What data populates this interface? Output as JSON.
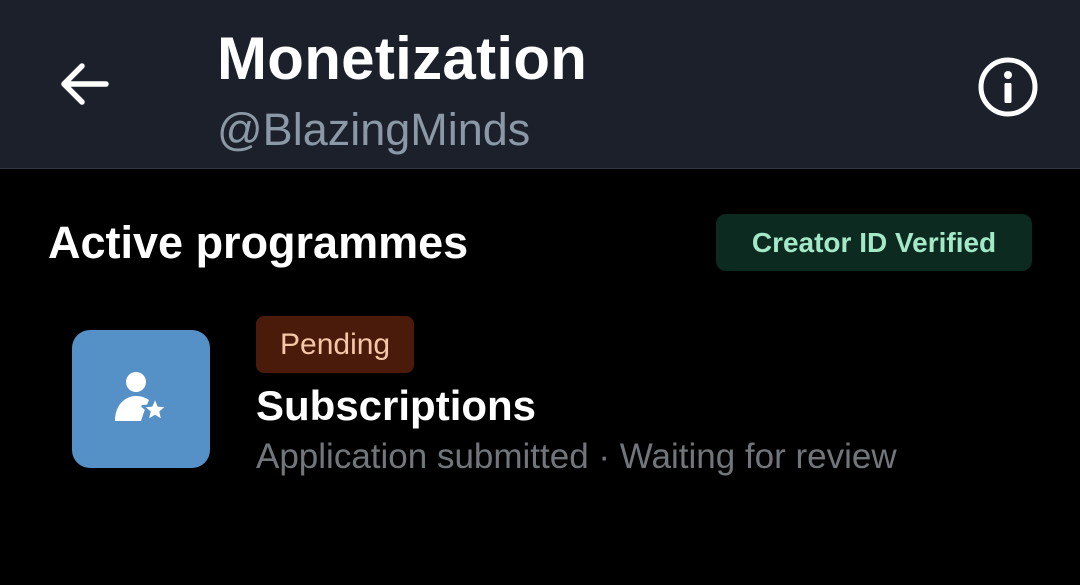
{
  "header": {
    "title": "Monetization",
    "handle": "@BlazingMinds",
    "back_icon": "arrow-left-icon",
    "info_icon": "info-circle-icon"
  },
  "section": {
    "title": "Active programmes",
    "verified_badge": "Creator ID Verified"
  },
  "programmes": [
    {
      "icon": "person-star-icon",
      "status_badge": "Pending",
      "name": "Subscriptions",
      "status_text": "Application submitted · Waiting for review"
    }
  ],
  "colors": {
    "header_bg": "#1b202b",
    "page_bg": "#000000",
    "verified_bg": "#0c2a20",
    "verified_text": "#a3e8c7",
    "pending_bg": "#4a1a0a",
    "pending_text": "#f6c6a8",
    "programme_icon_bg": "#5590c6"
  }
}
